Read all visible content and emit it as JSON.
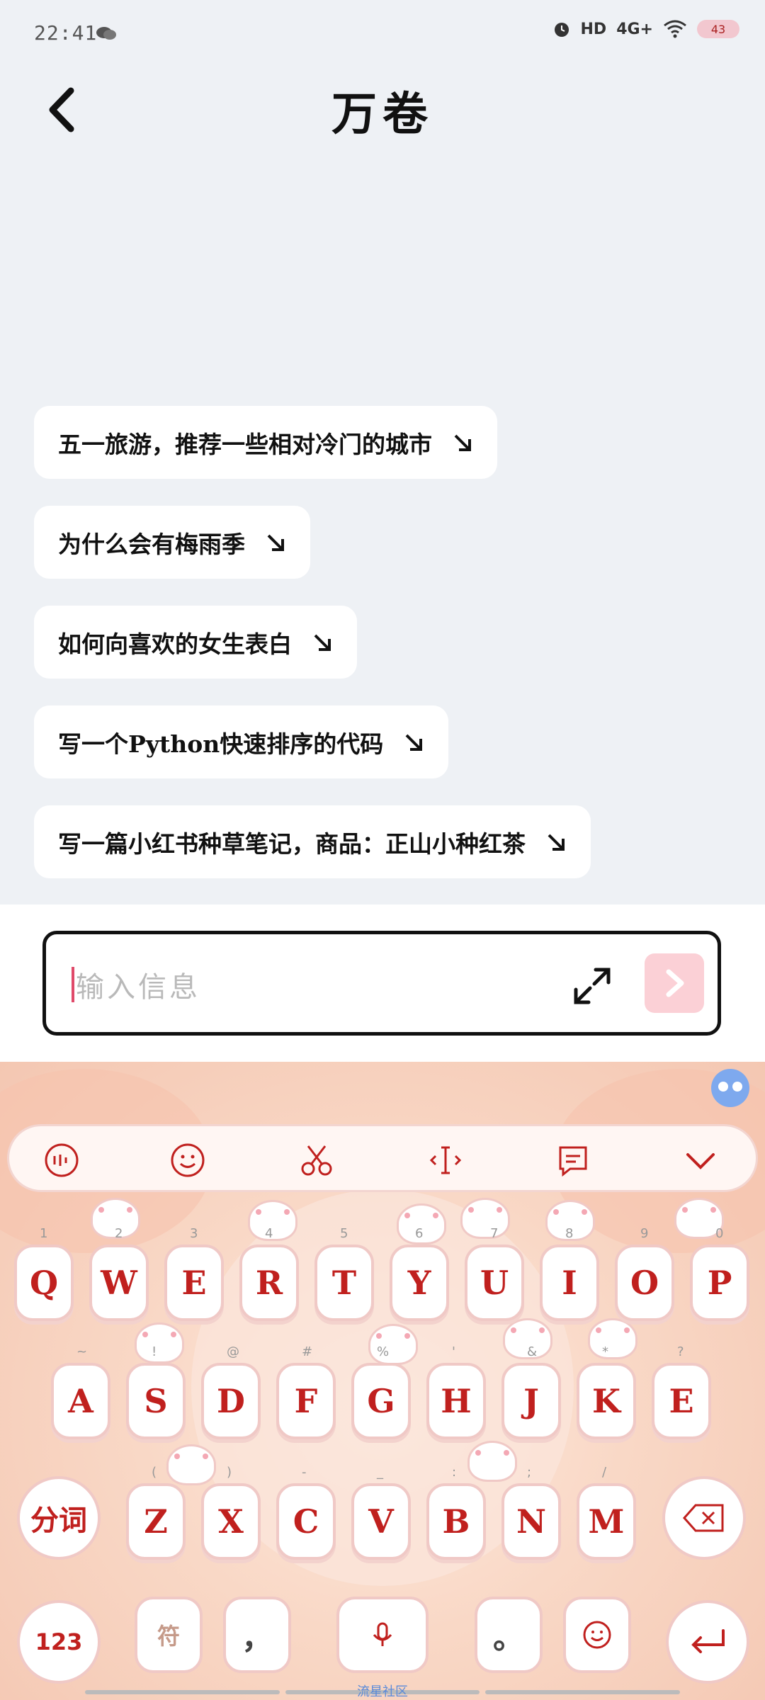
{
  "status_bar": {
    "time": "22:41",
    "icons": [
      "alarm-icon",
      "hd-icon",
      "signal-4g-icon",
      "wifi-icon"
    ],
    "network": "4G+",
    "hd": "HD",
    "battery": "43"
  },
  "header": {
    "title": "万卷",
    "back_icon": "chevron-left-icon"
  },
  "suggestions": [
    {
      "label": "五一旅游，推荐一些相对冷门的城市"
    },
    {
      "label": "为什么会有梅雨季"
    },
    {
      "label": "如何向喜欢的女生表白"
    },
    {
      "label": "写一个Python快速排序的代码"
    },
    {
      "label": "写一篇小红书种草笔记，商品：正山小种红茶"
    }
  ],
  "input": {
    "placeholder": "输入信息",
    "expand_icon": "expand-icon",
    "send_icon": "chevron-right-icon"
  },
  "keyboard": {
    "toolbar": [
      "voice-input-icon",
      "emoji-icon",
      "scissors-icon",
      "cursor-icon",
      "clipboard-icon",
      "collapse-chevron-icon"
    ],
    "row1": [
      {
        "key": "Q",
        "sup": "1"
      },
      {
        "key": "W",
        "sup": "2"
      },
      {
        "key": "E",
        "sup": "3"
      },
      {
        "key": "R",
        "sup": "4"
      },
      {
        "key": "T",
        "sup": "5"
      },
      {
        "key": "Y",
        "sup": "6"
      },
      {
        "key": "U",
        "sup": "7"
      },
      {
        "key": "I",
        "sup": "8"
      },
      {
        "key": "O",
        "sup": "9"
      },
      {
        "key": "P",
        "sup": "0"
      }
    ],
    "row2": [
      {
        "key": "A",
        "sup": "~"
      },
      {
        "key": "S",
        "sup": "!"
      },
      {
        "key": "D",
        "sup": "@"
      },
      {
        "key": "F",
        "sup": "#"
      },
      {
        "key": "G",
        "sup": "%"
      },
      {
        "key": "H",
        "sup": "'"
      },
      {
        "key": "J",
        "sup": "&"
      },
      {
        "key": "K",
        "sup": "*"
      },
      {
        "key": "E",
        "sup": "?"
      }
    ],
    "row3": [
      {
        "key": "Z",
        "sup": "("
      },
      {
        "key": "X",
        "sup": ")"
      },
      {
        "key": "C",
        "sup": "-"
      },
      {
        "key": "V",
        "sup": "_"
      },
      {
        "key": "B",
        "sup": ":"
      },
      {
        "key": "N",
        "sup": ";"
      },
      {
        "key": "M",
        "sup": "/"
      }
    ],
    "fenci": "分词",
    "num_key": "123",
    "fu_key": "符",
    "comma": "，",
    "period": "。",
    "community": "流星社区"
  }
}
